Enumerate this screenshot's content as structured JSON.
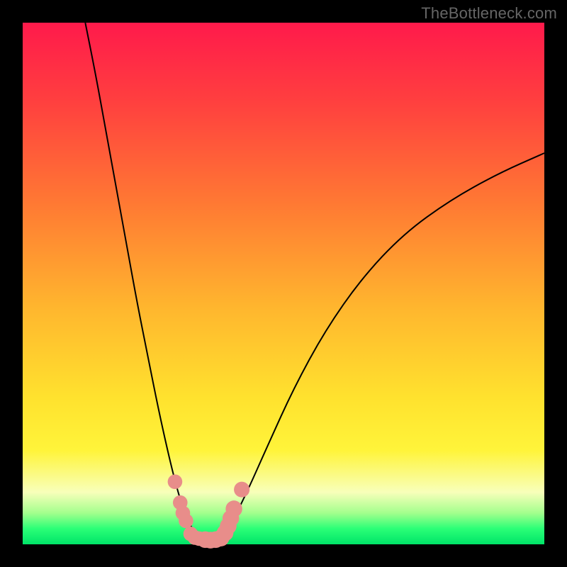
{
  "watermark": "TheBottleneck.com",
  "colors": {
    "curve": "#000000",
    "marker_fill": "#e88d8a",
    "marker_stroke": "#e88d8a"
  },
  "chart_data": {
    "type": "line",
    "title": "",
    "xlabel": "",
    "ylabel": "",
    "xlim": [
      0,
      100
    ],
    "ylim": [
      0,
      100
    ],
    "grid": false,
    "legend": false,
    "series": [
      {
        "name": "left-branch",
        "x": [
          12,
          14,
          16,
          18,
          20,
          22,
          24,
          26,
          28,
          29.5,
          31,
          32.5,
          33.5
        ],
        "y": [
          100,
          90,
          79,
          68,
          57,
          46,
          36,
          26,
          17,
          11,
          6,
          3,
          1.2
        ]
      },
      {
        "name": "right-branch",
        "x": [
          38,
          40,
          43,
          47,
          52,
          58,
          65,
          73,
          82,
          91,
          100
        ],
        "y": [
          1.2,
          4,
          10,
          19,
          30,
          41,
          51,
          59.5,
          66,
          71,
          75
        ]
      }
    ],
    "markers": {
      "name": "valley-points",
      "points": [
        {
          "x": 29.2,
          "y": 12.0,
          "r": 1.4
        },
        {
          "x": 30.2,
          "y": 8.0,
          "r": 1.4
        },
        {
          "x": 30.7,
          "y": 6.0,
          "r": 1.4
        },
        {
          "x": 31.3,
          "y": 4.5,
          "r": 1.4
        },
        {
          "x": 32.2,
          "y": 2.0,
          "r": 1.4
        },
        {
          "x": 33.0,
          "y": 1.3,
          "r": 1.4
        },
        {
          "x": 33.8,
          "y": 1.1,
          "r": 1.4
        },
        {
          "x": 35.0,
          "y": 0.9,
          "r": 1.6
        },
        {
          "x": 36.0,
          "y": 0.8,
          "r": 1.6
        },
        {
          "x": 37.0,
          "y": 0.9,
          "r": 1.6
        },
        {
          "x": 38.0,
          "y": 1.2,
          "r": 1.6
        },
        {
          "x": 38.8,
          "y": 2.2,
          "r": 1.6
        },
        {
          "x": 39.4,
          "y": 3.5,
          "r": 1.6
        },
        {
          "x": 39.9,
          "y": 5.0,
          "r": 1.6
        },
        {
          "x": 40.5,
          "y": 6.8,
          "r": 1.6
        },
        {
          "x": 42.0,
          "y": 10.5,
          "r": 1.5
        }
      ]
    }
  }
}
